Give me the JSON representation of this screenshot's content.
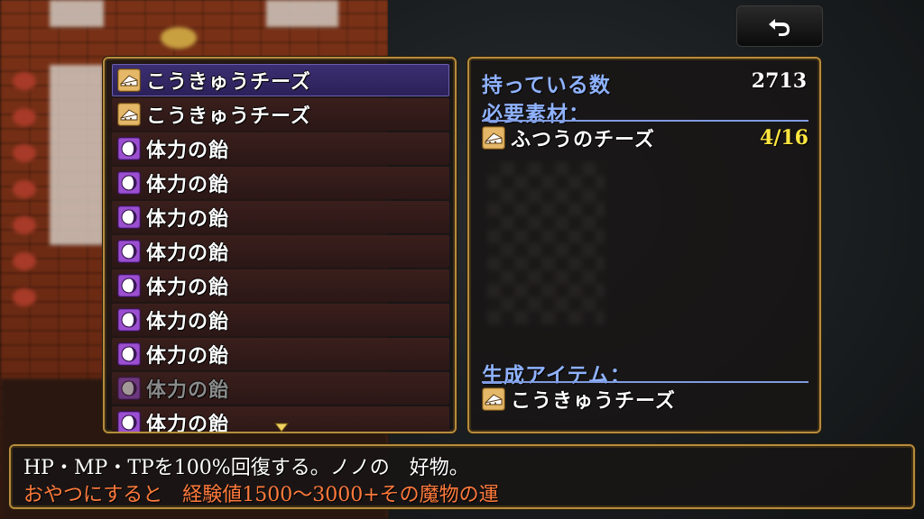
{
  "list": {
    "items": [
      {
        "label": "こうきゅうチーズ",
        "icon": "cheese-icon",
        "state": "selected"
      },
      {
        "label": "こうきゅうチーズ",
        "icon": "cheese-icon",
        "state": "normal"
      },
      {
        "label": "体力の飴",
        "icon": "candy-icon",
        "state": "normal"
      },
      {
        "label": "体力の飴",
        "icon": "candy-icon",
        "state": "normal"
      },
      {
        "label": "体力の飴",
        "icon": "candy-icon",
        "state": "normal"
      },
      {
        "label": "体力の飴",
        "icon": "candy-icon",
        "state": "normal"
      },
      {
        "label": "体力の飴",
        "icon": "candy-icon",
        "state": "normal"
      },
      {
        "label": "体力の飴",
        "icon": "candy-icon",
        "state": "normal"
      },
      {
        "label": "体力の飴",
        "icon": "candy-icon",
        "state": "normal"
      },
      {
        "label": "体力の飴",
        "icon": "candy-icon",
        "state": "disabled"
      },
      {
        "label": "体力の飴",
        "icon": "candy-icon",
        "state": "normal"
      }
    ]
  },
  "detail": {
    "owned_label": "持っている数",
    "owned_value": "2713",
    "required_label": "必要素材：",
    "required_item": {
      "label": "ふつうのチーズ",
      "icon": "cheese-icon",
      "count": "4/16"
    },
    "product_label": "生成アイテム：",
    "product_item": {
      "label": "こうきゅうチーズ",
      "icon": "cheese-icon"
    }
  },
  "help": {
    "line1": "HP・MP・TPを100%回復する。ノノの　好物。",
    "line2": "おやつにすると　経験値1500～3000+その魔物の運"
  },
  "colors": {
    "panel_border": "#b68c3e",
    "selected_row": "#3c2f72",
    "label_blue": "#8fb2ff",
    "count_yellow": "#ffe640",
    "help_orange": "#ff7a3c"
  }
}
